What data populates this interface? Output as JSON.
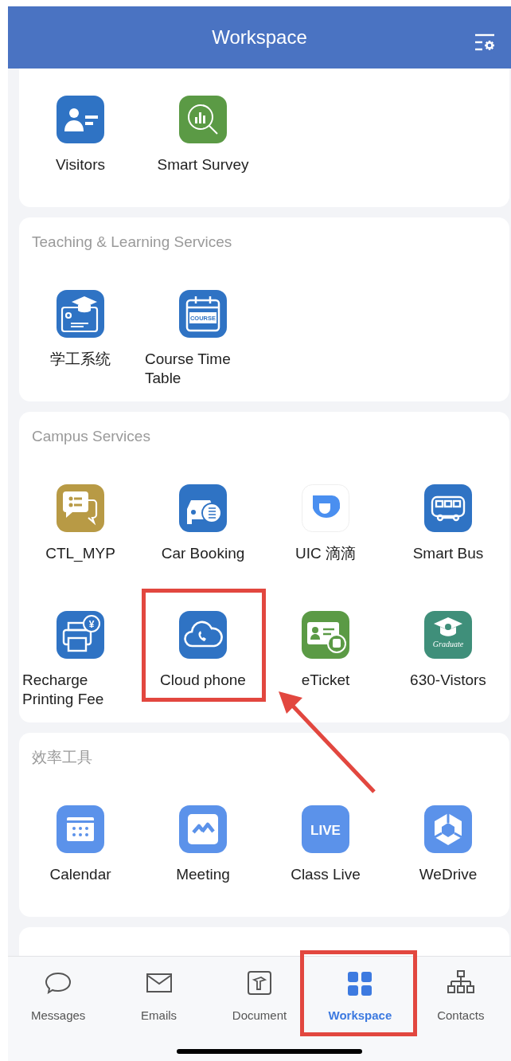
{
  "header": {
    "title": "Workspace"
  },
  "sections": [
    {
      "items": [
        {
          "label": "Visitors",
          "highlighted": false
        },
        {
          "label": "Smart Survey",
          "highlighted": false
        }
      ]
    },
    {
      "title": "Teaching & Learning Services",
      "items": [
        {
          "label": "学工系统",
          "highlighted": false
        },
        {
          "label": "Course Time Table",
          "icon_text": "COURSE",
          "highlighted": false
        }
      ]
    },
    {
      "title": "Campus Services",
      "items": [
        {
          "label": "CTL_MYP",
          "highlighted": false
        },
        {
          "label": "Car Booking",
          "highlighted": false
        },
        {
          "label": "UIC 滴滴",
          "highlighted": false
        },
        {
          "label": "Smart Bus",
          "highlighted": false
        },
        {
          "label": "Recharge Printing Fee",
          "icon_text": "¥",
          "highlighted": false
        },
        {
          "label": "Cloud phone",
          "highlighted": true
        },
        {
          "label": "eTicket",
          "highlighted": false
        },
        {
          "label": "630-Vistors",
          "icon_text": "Graduate",
          "highlighted": false
        }
      ]
    },
    {
      "title": "效率工具",
      "items": [
        {
          "label": "Calendar",
          "highlighted": false
        },
        {
          "label": "Meeting",
          "highlighted": false
        },
        {
          "label": "Class Live",
          "icon_text": "LIVE",
          "highlighted": false
        },
        {
          "label": "WeDrive",
          "highlighted": false
        }
      ]
    }
  ],
  "pointer_arrow": true,
  "tabs": [
    {
      "label": "Messages",
      "selected": false,
      "highlighted": false
    },
    {
      "label": "Emails",
      "selected": false,
      "highlighted": false
    },
    {
      "label": "Document",
      "selected": false,
      "highlighted": false
    },
    {
      "label": "Workspace",
      "selected": true,
      "highlighted": true
    },
    {
      "label": "Contacts",
      "selected": false,
      "highlighted": false
    }
  ]
}
